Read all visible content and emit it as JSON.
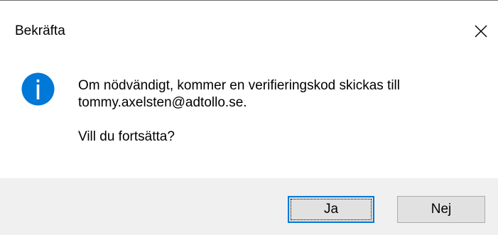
{
  "dialog": {
    "title": "Bekräfta",
    "close_icon": "close-icon",
    "icon": "info-icon",
    "accent_color": "#0078d7",
    "message_line1": "Om nödvändigt, kommer en verifieringskod skickas till",
    "message_line2": "tommy.axelsten@adtollo.se.",
    "question": "Vill du fortsätta?",
    "buttons": {
      "yes_label": "Ja",
      "no_label": "Nej"
    }
  }
}
